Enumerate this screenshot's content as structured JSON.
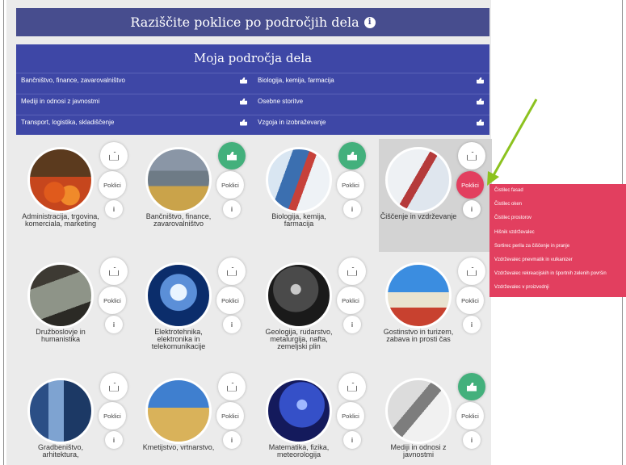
{
  "header": {
    "title": "Raziščite poklice po področjih dela",
    "info_icon": "info-icon"
  },
  "areas": {
    "title": "Moja področja dela",
    "items": [
      {
        "label": "Bančništvo, finance, zavarovalništvo"
      },
      {
        "label": "Biologija, kemija, farmacija"
      },
      {
        "label": "Mediji in odnosi z javnostmi"
      },
      {
        "label": "Osebne storitve"
      },
      {
        "label": "Transport, logistika, skladiščenje"
      },
      {
        "label": "Vzgoja in izobraževanje"
      }
    ]
  },
  "cards": [
    {
      "label": "Administracija, trgovina, komerciala, marketing",
      "liked": false,
      "photo": "market"
    },
    {
      "label": "Bančništvo, finance, zavarovalništvo",
      "liked": true,
      "photo": "bank"
    },
    {
      "label": "Biologija, kemija, farmacija",
      "liked": true,
      "photo": "lab"
    },
    {
      "label": "Čiščenje in vzdrževanje",
      "liked": false,
      "photo": "cleaning",
      "highlighted": true
    },
    {
      "label": "Družboslovje in humanistika",
      "liked": false,
      "photo": "reader"
    },
    {
      "label": "Elektrotehnika, elektronika in telekomunikacije",
      "liked": false,
      "photo": "bulb"
    },
    {
      "label": "Geologija, rudarstvo, metalurgija, nafta, zemeljski plin",
      "liked": false,
      "photo": "mine"
    },
    {
      "label": "Gostinstvo in turizem, zabava in prosti čas",
      "liked": false,
      "photo": "beach"
    },
    {
      "label": "Gradbeništvo, arhitektura,",
      "liked": false,
      "photo": "building"
    },
    {
      "label": "Kmetijstvo, vrtnarstvo,",
      "liked": false,
      "photo": "field"
    },
    {
      "label": "Matematika, fizika, meteorologija",
      "liked": false,
      "photo": "lightning"
    },
    {
      "label": "Mediji in odnosi z javnostmi",
      "liked": true,
      "photo": "phone"
    }
  ],
  "buttons": {
    "poklici": "Poklici",
    "info": "i"
  },
  "dropdown": {
    "items": [
      "Čistilec fasad",
      "Čistilec oken",
      "Čistilec prostorov",
      "Hišnik vzdrževalec",
      "Sortirec perila za čiščenje in pranje",
      "Vzdrževalec pnevmatik in vulkanizer",
      "Vzdrževalec rekreacijskih in športnih zelenih površin",
      "Vzdrževalec v proizvodnji"
    ]
  },
  "colors": {
    "header": "#474d8e",
    "areas": "#3e47a6",
    "liked": "#43b07c",
    "active": "#e23f5f",
    "arrow": "#8cc21f"
  }
}
